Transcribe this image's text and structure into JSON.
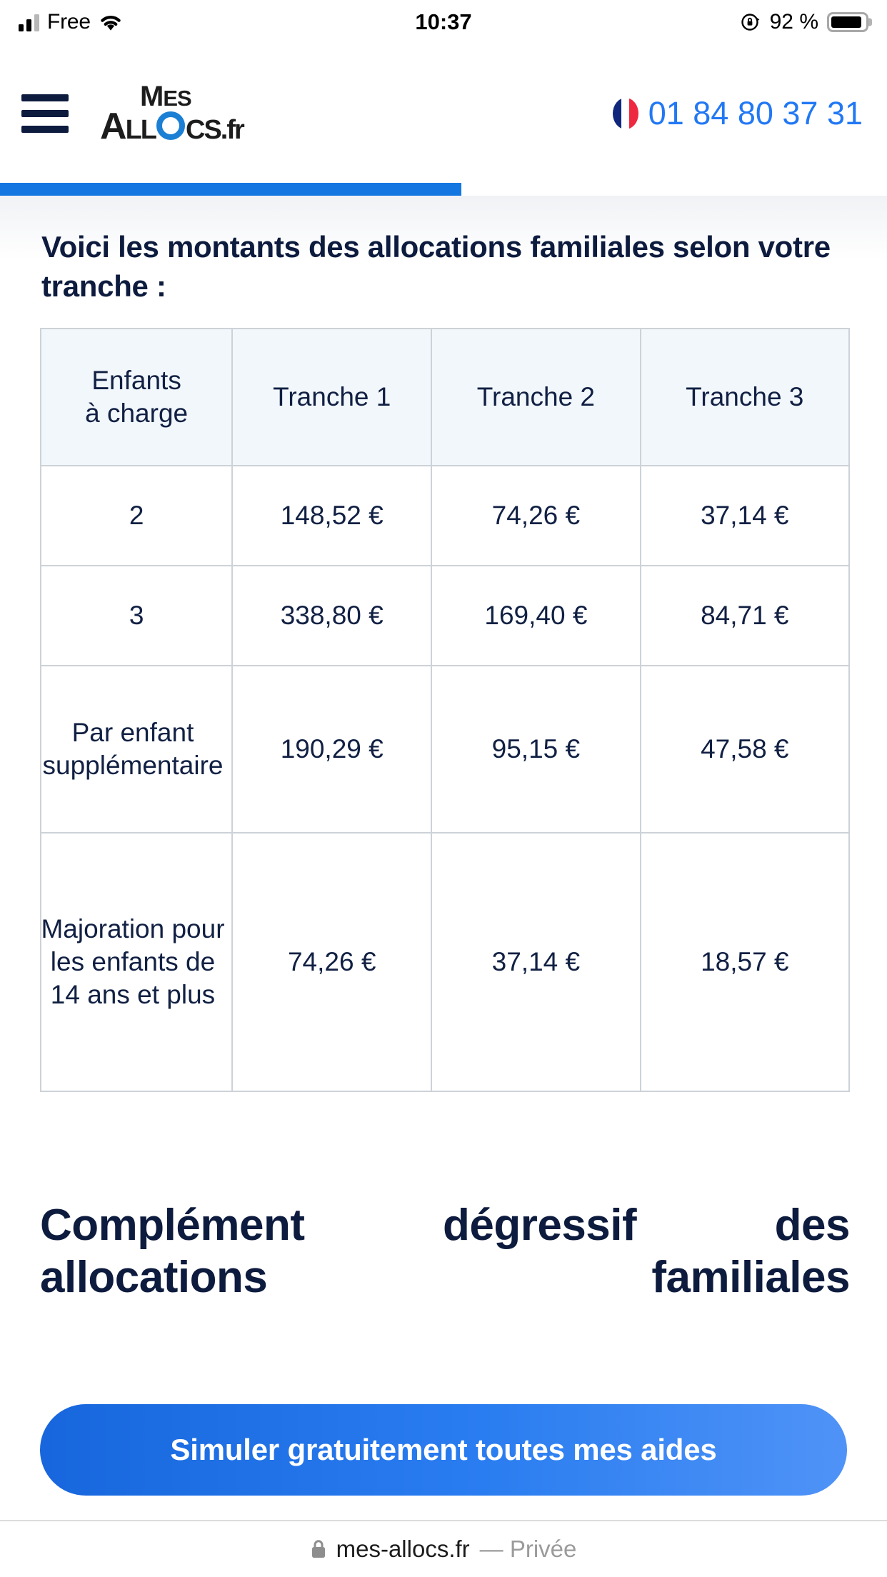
{
  "status_bar": {
    "carrier": "Free",
    "time": "10:37",
    "battery_percent": "92 %",
    "signal_icon": "cellular-signal-icon",
    "wifi_icon": "wifi-icon",
    "orientation_lock_icon": "rotation-lock-icon",
    "battery_icon": "battery-icon"
  },
  "header": {
    "menu_icon": "hamburger-menu-icon",
    "logo": {
      "top": "MES",
      "top_small": "ES",
      "top_cap": "M",
      "bottom_pre": "ALL",
      "bottom_post": "CS",
      "bottom_tld": ".fr",
      "circle_icon": "blue-ring-icon"
    },
    "flag_icon": "french-flag-icon",
    "phone": "01 84 80 37 31"
  },
  "progress": {
    "percent": 52,
    "color": "#1476e0"
  },
  "content": {
    "intro": "Voici les montants des allocations familiales selon votre tranche :",
    "section_heading_line1": "Complément dégressif des",
    "section_heading_line2": "allocations familiales"
  },
  "table": {
    "columns": [
      "Enfants à charge",
      "Tranche 1",
      "Tranche 2",
      "Tranche 3"
    ],
    "column_header_label_line1": "Enfants",
    "column_header_label_line2": "à charge",
    "rows": [
      {
        "label": "2",
        "t1": "148,52 €",
        "t2": "74,26 €",
        "t3": "37,14 €"
      },
      {
        "label": "3",
        "t1": "338,80 €",
        "t2": "169,40 €",
        "t3": "84,71 €"
      },
      {
        "label": "Par enfant supplémentaire",
        "t1": "190,29 €",
        "t2": "95,15 €",
        "t3": "47,58 €"
      },
      {
        "label": "Majoration pour les enfants de 14 ans et plus",
        "t1": "74,26 €",
        "t2": "37,14 €",
        "t3": "18,57 €"
      }
    ]
  },
  "cta": {
    "label": "Simuler gratuitement toutes mes aides",
    "gradient_from": "#1766dd",
    "gradient_to": "#4f93f7"
  },
  "browser_bar": {
    "lock_icon": "lock-icon",
    "url": "mes-allocs.fr",
    "private_label": "— Privée"
  }
}
